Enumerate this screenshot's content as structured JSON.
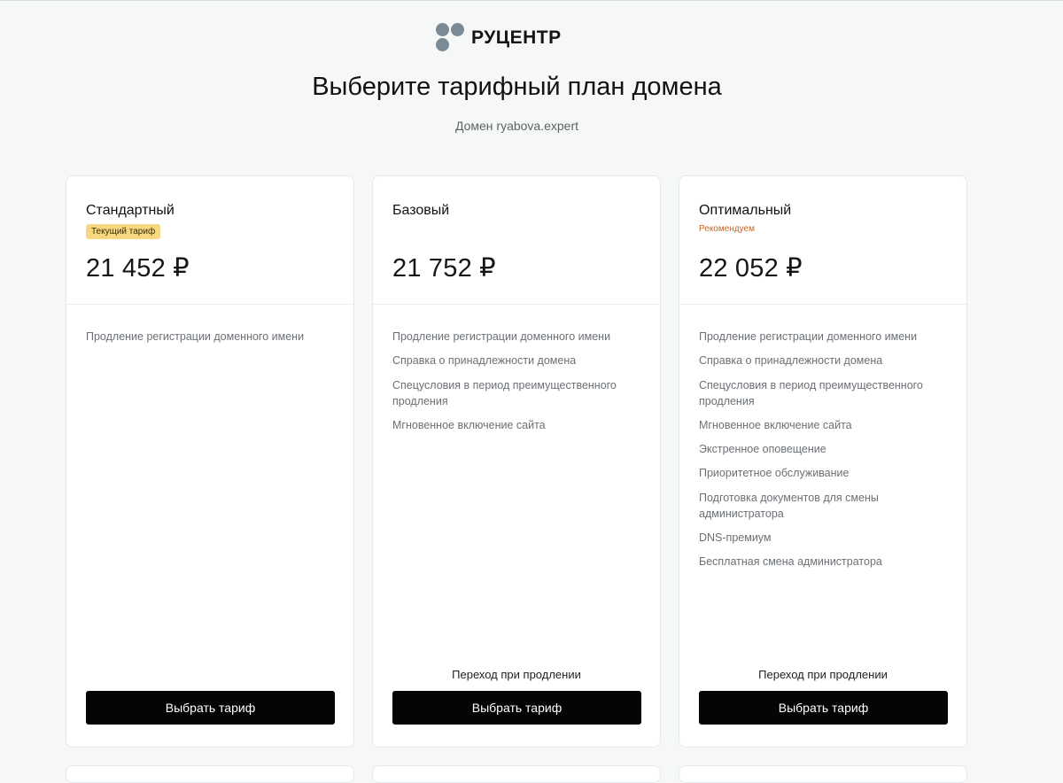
{
  "brand": {
    "name": "РУЦЕНТР",
    "logo_color": "#7b8b95"
  },
  "header": {
    "title": "Выберите тарифный план домена",
    "subtitle": "Домен ryabova.expert"
  },
  "plans": [
    {
      "name": "Стандартный",
      "badge": "Текущий тариф",
      "price": "21 452 ₽",
      "features": [
        "Продление регистрации доменного имени"
      ],
      "transition_note": "",
      "button_label": "Выбрать тариф"
    },
    {
      "name": "Базовый",
      "badge": "",
      "price": "21 752 ₽",
      "features": [
        "Продление регистрации доменного имени",
        "Справка о принадлежности домена",
        "Спецусловия в период преимущественного продления",
        "Мгновенное включение сайта"
      ],
      "transition_note": "Переход при продлении",
      "button_label": "Выбрать тариф"
    },
    {
      "name": "Оптимальный",
      "badge": "Рекомендуем",
      "price": "22 052 ₽",
      "features": [
        "Продление регистрации доменного имени",
        "Справка о принадлежности домена",
        "Спецусловия в период преимущественного продления",
        "Мгновенное включение сайта",
        "Экстренное оповещение",
        "Приоритетное обслуживание",
        "Подготовка документов для смены администратора",
        "DNS-премиум",
        "Бесплатная смена администратора"
      ],
      "transition_note": "Переход при продлении",
      "button_label": "Выбрать тариф"
    }
  ],
  "colors": {
    "current_badge_bg": "#f7d77f",
    "recommended_text": "#c0662c",
    "button_bg": "#050505"
  }
}
